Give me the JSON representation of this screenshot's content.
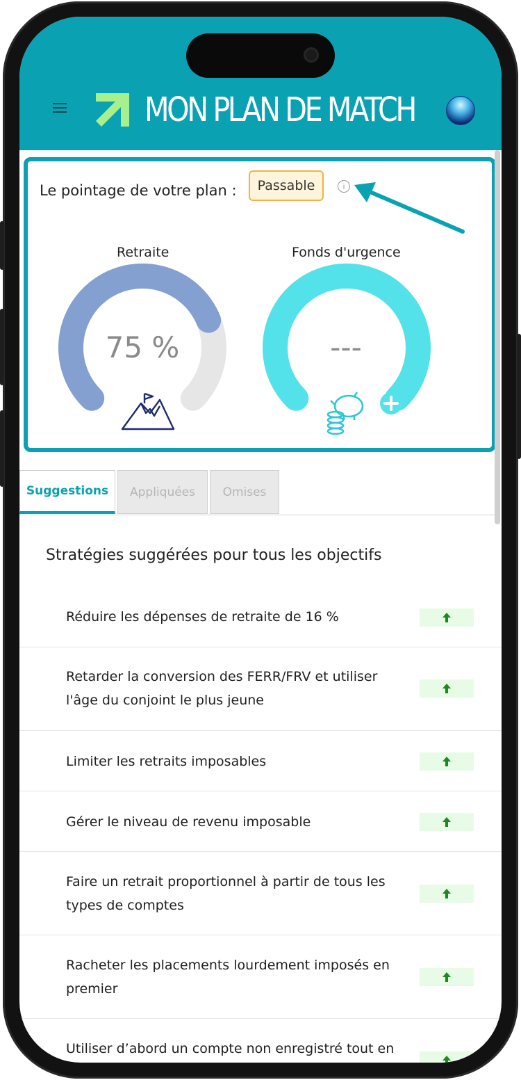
{
  "header": {
    "app_title": "MON PLAN DE MATCH"
  },
  "score": {
    "label": "Le pointage de votre plan :",
    "badge": "Passable",
    "info_glyph": "i"
  },
  "gauges": [
    {
      "title": "Retraite",
      "value_text": "75 %",
      "fraction": 0.75,
      "color": "#84a0d0",
      "icon": "mountain-flag-icon"
    },
    {
      "title": "Fonds d'urgence",
      "value_text": "---",
      "fraction": 1.0,
      "color": "#53e2ea",
      "icon": "piggy-bank-icon"
    }
  ],
  "tabs": [
    {
      "label": "Suggestions",
      "active": true
    },
    {
      "label": "Appliquées",
      "active": false
    },
    {
      "label": "Omises",
      "active": false
    }
  ],
  "section_title": "Stratégies suggérées pour tous les objectifs",
  "strategies": [
    {
      "line1": "Réduire les dépenses de retraite de 16 %",
      "line2": ""
    },
    {
      "line1": "Retarder la conversion des FERR/FRV et utiliser",
      "line2": "l'âge du conjoint le plus jeune"
    },
    {
      "line1": "Limiter les retraits imposables",
      "line2": ""
    },
    {
      "line1": "Gérer le niveau de revenu imposable",
      "line2": ""
    },
    {
      "line1": "Faire un retrait proportionnel à partir de tous les",
      "line2": "types de comptes"
    },
    {
      "line1": "Racheter les placements lourdement imposés en",
      "line2": "premier"
    },
    {
      "line1": "Utiliser d’abord un compte non enregistré tout en",
      "line2": ""
    }
  ],
  "colors": {
    "brand": "#0aa2b2",
    "arrow_green": "#1a8a1a",
    "badge_border": "#f2b441"
  }
}
